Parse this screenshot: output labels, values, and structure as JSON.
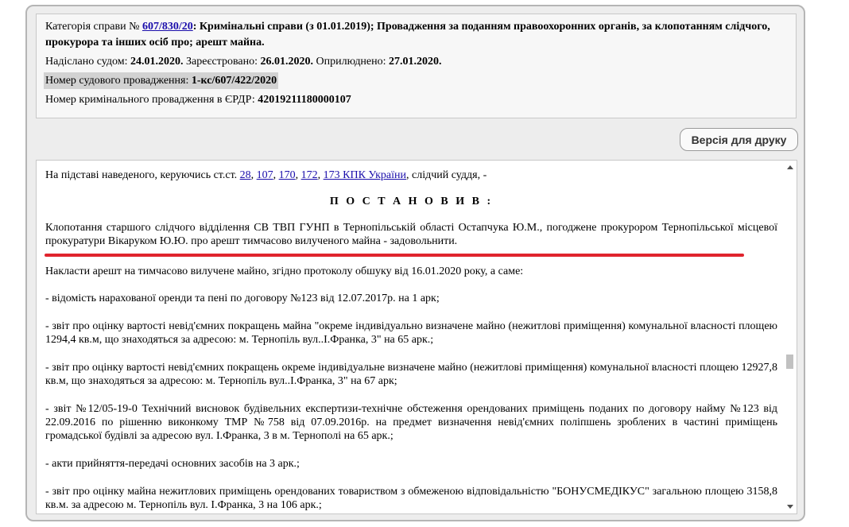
{
  "info": {
    "category_prefix": "Категорія справи №",
    "case_link": "607/830/20",
    "category_text": ": Кримінальні справи (з 01.01.2019); Провадження за поданням правоохоронних органів, за клопотанням слідчого, прокурора та інших осіб про; арешт майна.",
    "sent_label": "Надіслано судом:",
    "sent_date": "24.01.2020.",
    "registered_label": "Зареєстровано:",
    "registered_date": "26.01.2020.",
    "published_label": "Оприлюднено:",
    "published_date": "27.01.2020.",
    "court_number_label": "Номер судового провадження:",
    "court_number": "1-кс/607/422/2020",
    "erdr_label": "Номер кримінального провадження в ЄРДР:",
    "erdr_number": "42019211180000107"
  },
  "print_button": "Версія для друку",
  "document": {
    "intro_prefix": "На підставі наведеного, керуючись ст.ст.",
    "links": [
      "28",
      "107",
      "170",
      "172",
      "173 КПК України"
    ],
    "intro_suffix": ", слідчий суддя, -",
    "heading": "П О С Т А Н О В И В :",
    "para_a": "Клопотання старшого слідчого відділення СВ ТВП ГУНП в Тернопільській області Остапчука Ю.М., погоджене прокурором Тернопільської місцевої прокуратури Вікаруком Ю.Ю. про арешт тимчасово вилученого майна - задовольнити.",
    "para_b": "Накласти арешт на тимчасово вилучене майно, згідно протоколу обшуку від 16.01.2020 року, а саме:",
    "para_c": "- відомість нарахованої оренди та пені по договору №123 від 12.07.2017р. на 1 арк;",
    "para_d": "- звіт про оцінку вартості невід'ємних покращень майна \"окреме індивідуально визначене майно (нежитлові приміщення) комунальної власності площею 1294,4 кв.м, що знаходяться за адресою: м. Тернопіль вул..І.Франка, 3\" на 65 арк.;",
    "para_e": "- звіт про оцінку вартості невід'ємних покращень окреме індивідуальне визначене майно (нежитлові приміщення) комунальної власності площею 12927,8 кв.м, що знаходяться за адресою: м. Тернопіль вул..І.Франка, 3\" на 67 арк;",
    "para_f": "- звіт №12/05-19-0 Технічний висновок будівельних експертизи-технічне обстеження орендованих приміщень поданих по договору найму №123 від 22.09.2016 по рішенню виконкому ТМР №758 від 07.09.2016р. на предмет визначення невід'ємних поліпшень зроблених в частині приміщень громадської будівлі за адресою вул. І.Франка, 3 в м. Тернополі на 65 арк.;",
    "para_g": "- акти прийняття-передачі основних засобів на 3 арк.;",
    "para_h": "- звіт про оцінку майна нежитлових приміщень орендованих товариством з обмеженою відповідальністю \"БОНУСМЕДІКУС\" загальною площею 3158,8 кв.м. за адресою м. Тернопіль вул. І.Франка, 3 на 106 арк.;"
  },
  "colors": {
    "link": "#1a0dab",
    "annotation_underline": "#e0242d",
    "panel_bg": "#ededed"
  }
}
